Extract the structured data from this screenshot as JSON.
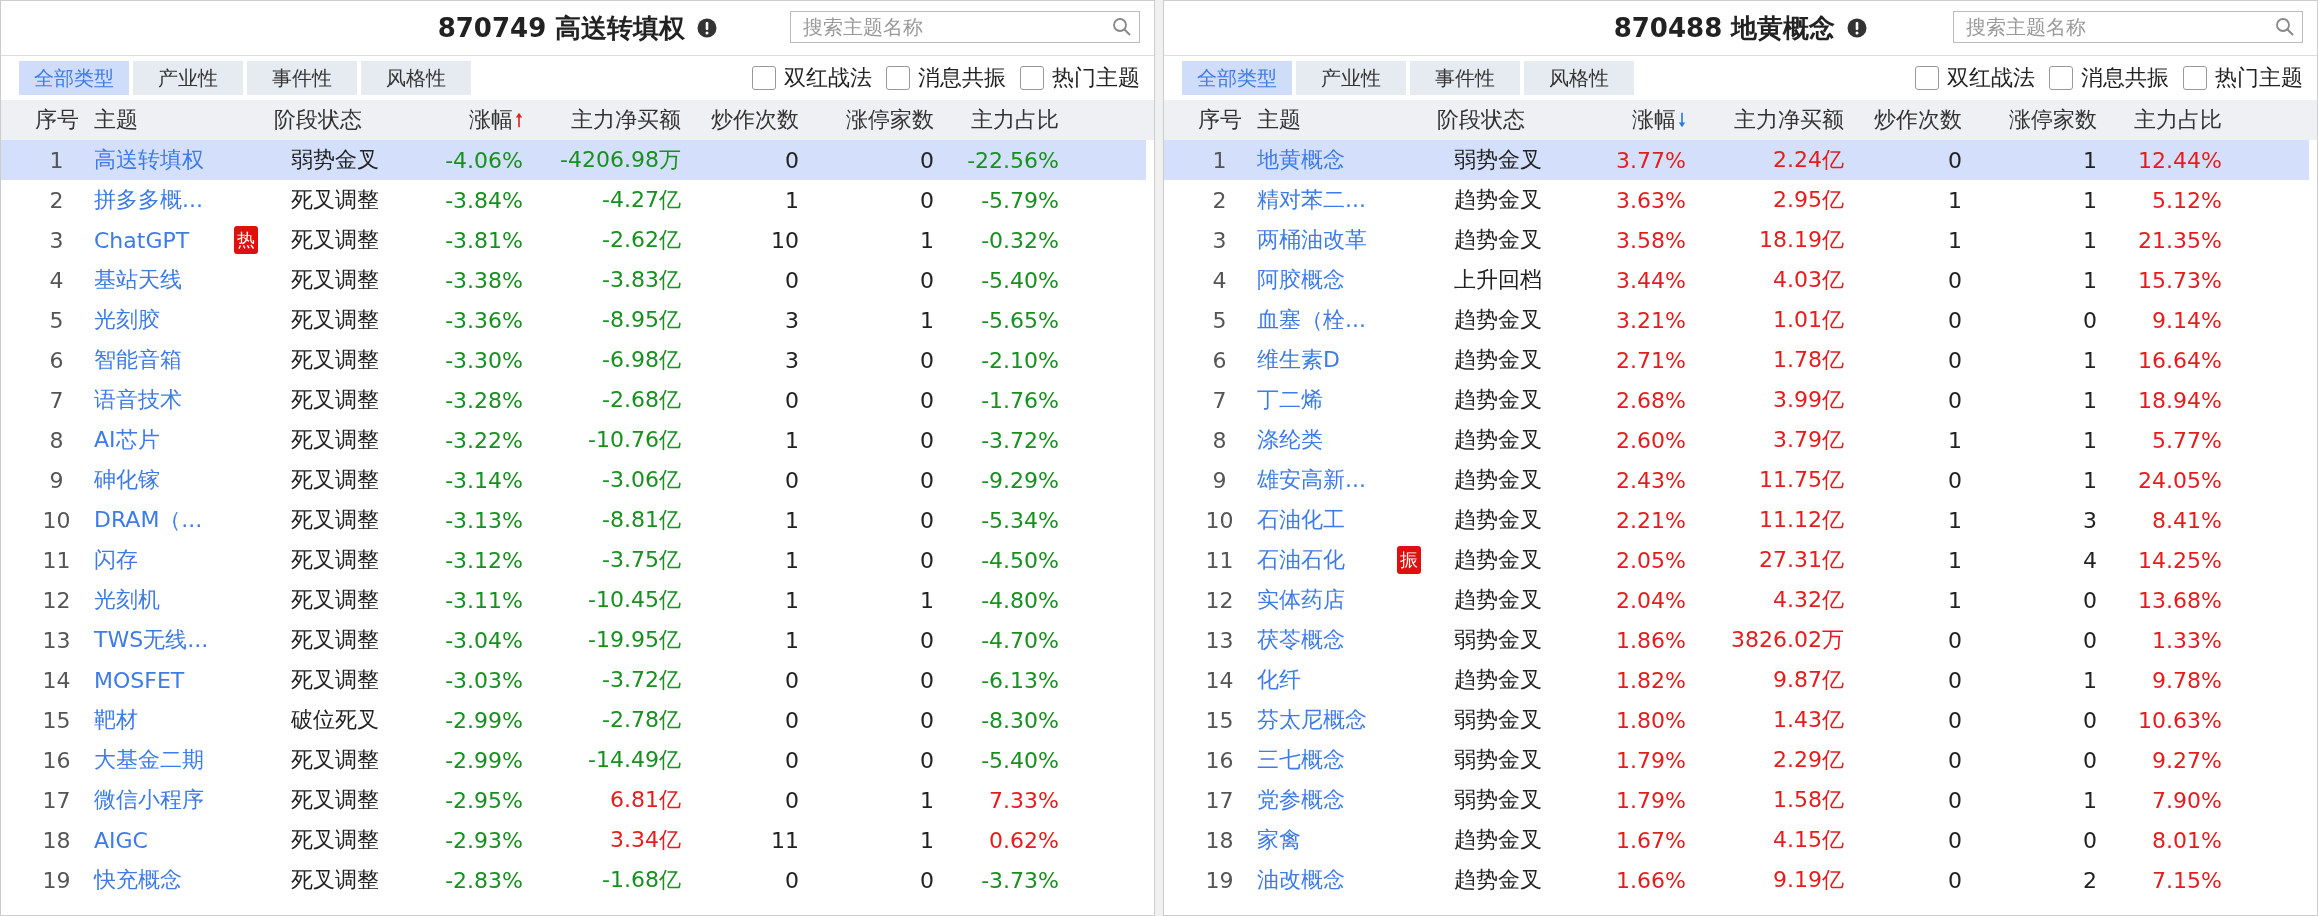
{
  "panels": [
    {
      "title": "870749 高送转填权",
      "search": {
        "placeholder": "搜索主题名称"
      },
      "tabs": [
        {
          "label": "全部类型",
          "selected": true
        },
        {
          "label": "产业性",
          "selected": false
        },
        {
          "label": "事件性",
          "selected": false
        },
        {
          "label": "风格性",
          "selected": false
        }
      ],
      "filters": [
        {
          "label": "双红战法",
          "checked": false
        },
        {
          "label": "消息共振",
          "checked": false
        },
        {
          "label": "热门主题",
          "checked": false
        }
      ],
      "columns": [
        "序号",
        "主题",
        "阶段状态",
        "涨幅",
        "主力净买额",
        "炒作次数",
        "涨停家数",
        "主力占比"
      ],
      "sort_ascending": true,
      "rows": [
        {
          "no": "1",
          "theme": "高送转填权",
          "stage": "弱势金叉",
          "change": "-4.06%",
          "change_up": false,
          "net": "-4206.98万",
          "net_up": false,
          "hype": "0",
          "limit": "0",
          "ratio": "-22.56%",
          "ratio_up": false,
          "selected": true
        },
        {
          "no": "2",
          "theme": "拼多多概...",
          "stage": "死叉调整",
          "change": "-3.84%",
          "change_up": false,
          "net": "-4.27亿",
          "net_up": false,
          "hype": "1",
          "limit": "0",
          "ratio": "-5.79%",
          "ratio_up": false,
          "selected": false
        },
        {
          "no": "3",
          "theme": "ChatGPT",
          "tag": "热",
          "stage": "死叉调整",
          "change": "-3.81%",
          "change_up": false,
          "net": "-2.62亿",
          "net_up": false,
          "hype": "10",
          "limit": "1",
          "ratio": "-0.32%",
          "ratio_up": false,
          "selected": false
        },
        {
          "no": "4",
          "theme": "基站天线",
          "stage": "死叉调整",
          "change": "-3.38%",
          "change_up": false,
          "net": "-3.83亿",
          "net_up": false,
          "hype": "0",
          "limit": "0",
          "ratio": "-5.40%",
          "ratio_up": false,
          "selected": false
        },
        {
          "no": "5",
          "theme": "光刻胶",
          "stage": "死叉调整",
          "change": "-3.36%",
          "change_up": false,
          "net": "-8.95亿",
          "net_up": false,
          "hype": "3",
          "limit": "1",
          "ratio": "-5.65%",
          "ratio_up": false,
          "selected": false
        },
        {
          "no": "6",
          "theme": "智能音箱",
          "stage": "死叉调整",
          "change": "-3.30%",
          "change_up": false,
          "net": "-6.98亿",
          "net_up": false,
          "hype": "3",
          "limit": "0",
          "ratio": "-2.10%",
          "ratio_up": false,
          "selected": false
        },
        {
          "no": "7",
          "theme": "语音技术",
          "stage": "死叉调整",
          "change": "-3.28%",
          "change_up": false,
          "net": "-2.68亿",
          "net_up": false,
          "hype": "0",
          "limit": "0",
          "ratio": "-1.76%",
          "ratio_up": false,
          "selected": false
        },
        {
          "no": "8",
          "theme": "AI芯片",
          "stage": "死叉调整",
          "change": "-3.22%",
          "change_up": false,
          "net": "-10.76亿",
          "net_up": false,
          "hype": "1",
          "limit": "0",
          "ratio": "-3.72%",
          "ratio_up": false,
          "selected": false
        },
        {
          "no": "9",
          "theme": "砷化镓",
          "stage": "死叉调整",
          "change": "-3.14%",
          "change_up": false,
          "net": "-3.06亿",
          "net_up": false,
          "hype": "0",
          "limit": "0",
          "ratio": "-9.29%",
          "ratio_up": false,
          "selected": false
        },
        {
          "no": "10",
          "theme": "DRAM（...",
          "stage": "死叉调整",
          "change": "-3.13%",
          "change_up": false,
          "net": "-8.81亿",
          "net_up": false,
          "hype": "1",
          "limit": "0",
          "ratio": "-5.34%",
          "ratio_up": false,
          "selected": false
        },
        {
          "no": "11",
          "theme": "闪存",
          "stage": "死叉调整",
          "change": "-3.12%",
          "change_up": false,
          "net": "-3.75亿",
          "net_up": false,
          "hype": "1",
          "limit": "0",
          "ratio": "-4.50%",
          "ratio_up": false,
          "selected": false
        },
        {
          "no": "12",
          "theme": "光刻机",
          "stage": "死叉调整",
          "change": "-3.11%",
          "change_up": false,
          "net": "-10.45亿",
          "net_up": false,
          "hype": "1",
          "limit": "1",
          "ratio": "-4.80%",
          "ratio_up": false,
          "selected": false
        },
        {
          "no": "13",
          "theme": "TWS无线...",
          "stage": "死叉调整",
          "change": "-3.04%",
          "change_up": false,
          "net": "-19.95亿",
          "net_up": false,
          "hype": "1",
          "limit": "0",
          "ratio": "-4.70%",
          "ratio_up": false,
          "selected": false
        },
        {
          "no": "14",
          "theme": "MOSFET",
          "stage": "死叉调整",
          "change": "-3.03%",
          "change_up": false,
          "net": "-3.72亿",
          "net_up": false,
          "hype": "0",
          "limit": "0",
          "ratio": "-6.13%",
          "ratio_up": false,
          "selected": false
        },
        {
          "no": "15",
          "theme": "靶材",
          "stage": "破位死叉",
          "change": "-2.99%",
          "change_up": false,
          "net": "-2.78亿",
          "net_up": false,
          "hype": "0",
          "limit": "0",
          "ratio": "-8.30%",
          "ratio_up": false,
          "selected": false
        },
        {
          "no": "16",
          "theme": "大基金二期",
          "stage": "死叉调整",
          "change": "-2.99%",
          "change_up": false,
          "net": "-14.49亿",
          "net_up": false,
          "hype": "0",
          "limit": "0",
          "ratio": "-5.40%",
          "ratio_up": false,
          "selected": false
        },
        {
          "no": "17",
          "theme": "微信小程序",
          "stage": "死叉调整",
          "change": "-2.95%",
          "change_up": false,
          "net": "6.81亿",
          "net_up": true,
          "hype": "0",
          "limit": "1",
          "ratio": "7.33%",
          "ratio_up": true,
          "selected": false
        },
        {
          "no": "18",
          "theme": "AIGC",
          "stage": "死叉调整",
          "change": "-2.93%",
          "change_up": false,
          "net": "3.34亿",
          "net_up": true,
          "hype": "11",
          "limit": "1",
          "ratio": "0.62%",
          "ratio_up": true,
          "selected": false
        },
        {
          "no": "19",
          "theme": "快充概念",
          "stage": "死叉调整",
          "change": "-2.83%",
          "change_up": false,
          "net": "-1.68亿",
          "net_up": false,
          "hype": "0",
          "limit": "0",
          "ratio": "-3.73%",
          "ratio_up": false,
          "selected": false
        }
      ]
    },
    {
      "title": "870488 地黄概念",
      "search": {
        "placeholder": "搜索主题名称"
      },
      "tabs": [
        {
          "label": "全部类型",
          "selected": true
        },
        {
          "label": "产业性",
          "selected": false
        },
        {
          "label": "事件性",
          "selected": false
        },
        {
          "label": "风格性",
          "selected": false
        }
      ],
      "filters": [
        {
          "label": "双红战法",
          "checked": false
        },
        {
          "label": "消息共振",
          "checked": false
        },
        {
          "label": "热门主题",
          "checked": false
        }
      ],
      "columns": [
        "序号",
        "主题",
        "阶段状态",
        "涨幅",
        "主力净买额",
        "炒作次数",
        "涨停家数",
        "主力占比"
      ],
      "sort_ascending": false,
      "rows": [
        {
          "no": "1",
          "theme": "地黄概念",
          "stage": "弱势金叉",
          "change": "3.77%",
          "change_up": true,
          "net": "2.24亿",
          "net_up": true,
          "hype": "0",
          "limit": "1",
          "ratio": "12.44%",
          "ratio_up": true,
          "selected": true
        },
        {
          "no": "2",
          "theme": "精对苯二...",
          "stage": "趋势金叉",
          "change": "3.63%",
          "change_up": true,
          "net": "2.95亿",
          "net_up": true,
          "hype": "1",
          "limit": "1",
          "ratio": "5.12%",
          "ratio_up": true,
          "selected": false
        },
        {
          "no": "3",
          "theme": "两桶油改革",
          "stage": "趋势金叉",
          "change": "3.58%",
          "change_up": true,
          "net": "18.19亿",
          "net_up": true,
          "hype": "1",
          "limit": "1",
          "ratio": "21.35%",
          "ratio_up": true,
          "selected": false
        },
        {
          "no": "4",
          "theme": "阿胶概念",
          "stage": "上升回档",
          "change": "3.44%",
          "change_up": true,
          "net": "4.03亿",
          "net_up": true,
          "hype": "0",
          "limit": "1",
          "ratio": "15.73%",
          "ratio_up": true,
          "selected": false
        },
        {
          "no": "5",
          "theme": "血塞（栓...",
          "stage": "趋势金叉",
          "change": "3.21%",
          "change_up": true,
          "net": "1.01亿",
          "net_up": true,
          "hype": "0",
          "limit": "0",
          "ratio": "9.14%",
          "ratio_up": true,
          "selected": false
        },
        {
          "no": "6",
          "theme": "维生素D",
          "stage": "趋势金叉",
          "change": "2.71%",
          "change_up": true,
          "net": "1.78亿",
          "net_up": true,
          "hype": "0",
          "limit": "1",
          "ratio": "16.64%",
          "ratio_up": true,
          "selected": false
        },
        {
          "no": "7",
          "theme": "丁二烯",
          "stage": "趋势金叉",
          "change": "2.68%",
          "change_up": true,
          "net": "3.99亿",
          "net_up": true,
          "hype": "0",
          "limit": "1",
          "ratio": "18.94%",
          "ratio_up": true,
          "selected": false
        },
        {
          "no": "8",
          "theme": "涤纶类",
          "stage": "趋势金叉",
          "change": "2.60%",
          "change_up": true,
          "net": "3.79亿",
          "net_up": true,
          "hype": "1",
          "limit": "1",
          "ratio": "5.77%",
          "ratio_up": true,
          "selected": false
        },
        {
          "no": "9",
          "theme": "雄安高新...",
          "stage": "趋势金叉",
          "change": "2.43%",
          "change_up": true,
          "net": "11.75亿",
          "net_up": true,
          "hype": "0",
          "limit": "1",
          "ratio": "24.05%",
          "ratio_up": true,
          "selected": false
        },
        {
          "no": "10",
          "theme": "石油化工",
          "stage": "趋势金叉",
          "change": "2.21%",
          "change_up": true,
          "net": "11.12亿",
          "net_up": true,
          "hype": "1",
          "limit": "3",
          "ratio": "8.41%",
          "ratio_up": true,
          "selected": false
        },
        {
          "no": "11",
          "theme": "石油石化",
          "tag": "振",
          "stage": "趋势金叉",
          "change": "2.05%",
          "change_up": true,
          "net": "27.31亿",
          "net_up": true,
          "hype": "1",
          "limit": "4",
          "ratio": "14.25%",
          "ratio_up": true,
          "selected": false
        },
        {
          "no": "12",
          "theme": "实体药店",
          "stage": "趋势金叉",
          "change": "2.04%",
          "change_up": true,
          "net": "4.32亿",
          "net_up": true,
          "hype": "1",
          "limit": "0",
          "ratio": "13.68%",
          "ratio_up": true,
          "selected": false
        },
        {
          "no": "13",
          "theme": "茯苓概念",
          "stage": "弱势金叉",
          "change": "1.86%",
          "change_up": true,
          "net": "3826.02万",
          "net_up": true,
          "hype": "0",
          "limit": "0",
          "ratio": "1.33%",
          "ratio_up": true,
          "selected": false
        },
        {
          "no": "14",
          "theme": "化纤",
          "stage": "趋势金叉",
          "change": "1.82%",
          "change_up": true,
          "net": "9.87亿",
          "net_up": true,
          "hype": "0",
          "limit": "1",
          "ratio": "9.78%",
          "ratio_up": true,
          "selected": false
        },
        {
          "no": "15",
          "theme": "芬太尼概念",
          "stage": "弱势金叉",
          "change": "1.80%",
          "change_up": true,
          "net": "1.43亿",
          "net_up": true,
          "hype": "0",
          "limit": "0",
          "ratio": "10.63%",
          "ratio_up": true,
          "selected": false
        },
        {
          "no": "16",
          "theme": "三七概念",
          "stage": "弱势金叉",
          "change": "1.79%",
          "change_up": true,
          "net": "2.29亿",
          "net_up": true,
          "hype": "0",
          "limit": "0",
          "ratio": "9.27%",
          "ratio_up": true,
          "selected": false
        },
        {
          "no": "17",
          "theme": "党参概念",
          "stage": "弱势金叉",
          "change": "1.79%",
          "change_up": true,
          "net": "1.58亿",
          "net_up": true,
          "hype": "0",
          "limit": "1",
          "ratio": "7.90%",
          "ratio_up": true,
          "selected": false
        },
        {
          "no": "18",
          "theme": "家禽",
          "stage": "趋势金叉",
          "change": "1.67%",
          "change_up": true,
          "net": "4.15亿",
          "net_up": true,
          "hype": "0",
          "limit": "0",
          "ratio": "8.01%",
          "ratio_up": true,
          "selected": false
        },
        {
          "no": "19",
          "theme": "油改概念",
          "stage": "趋势金叉",
          "change": "1.66%",
          "change_up": true,
          "net": "9.19亿",
          "net_up": true,
          "hype": "0",
          "limit": "2",
          "ratio": "7.15%",
          "ratio_up": true,
          "selected": false
        }
      ]
    }
  ]
}
